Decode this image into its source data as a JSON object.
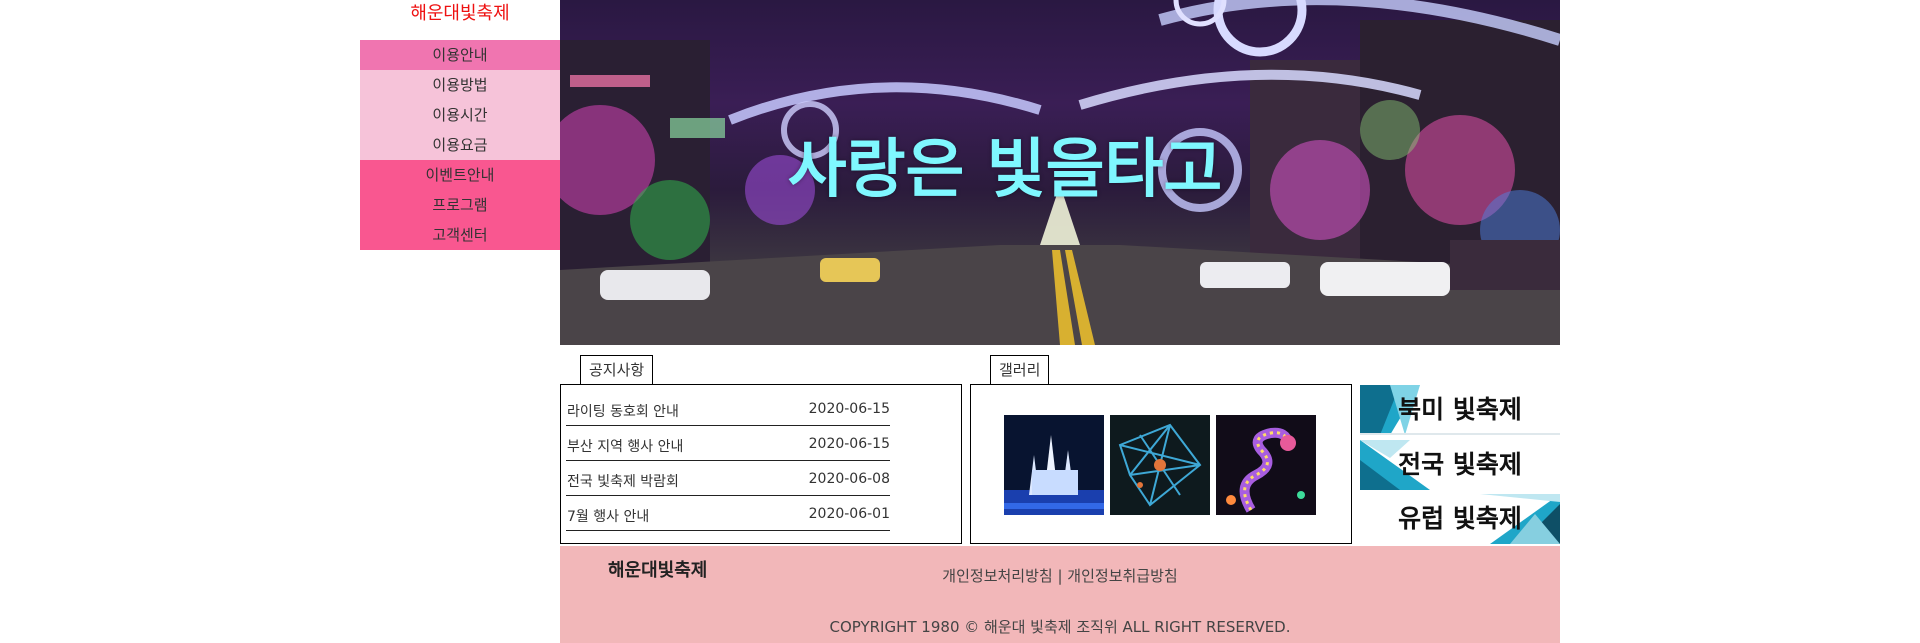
{
  "site": {
    "logo": "해운대빛축제"
  },
  "nav": {
    "items": [
      {
        "label": "이용안내",
        "bg": "#f075b0"
      },
      {
        "label": "이용방법",
        "bg": "#f6c3d9"
      },
      {
        "label": "이용시간",
        "bg": "#f6c3d9"
      },
      {
        "label": "이용요금",
        "bg": "#f6c3d9"
      },
      {
        "label": "이벤트안내",
        "bg": "#f95790"
      },
      {
        "label": "프로그램",
        "bg": "#f95790"
      },
      {
        "label": "고객센터",
        "bg": "#f95790"
      }
    ]
  },
  "hero": {
    "title": "사랑은 빛을타고"
  },
  "notice": {
    "tab_label": "공지사항",
    "rows": [
      {
        "title": "라이팅 동호회 안내",
        "date": "2020-06-15"
      },
      {
        "title": "부산 지역 행사 안내",
        "date": "2020-06-15"
      },
      {
        "title": "전국 빛축제 박람회",
        "date": "2020-06-08"
      },
      {
        "title": "7월 행사 안내",
        "date": "2020-06-01"
      }
    ]
  },
  "gallery": {
    "tab_label": "갤러리",
    "images": [
      "illuminated-castle",
      "light-web-sculpture",
      "light-dragon"
    ]
  },
  "banners": [
    {
      "label": "북미 빛축제"
    },
    {
      "label": "전국 빛축제"
    },
    {
      "label": "유럽 빛축제"
    }
  ],
  "footer": {
    "logo": "해운대빛축제",
    "links": [
      "개인정보처리방침",
      "개인정보취급방침"
    ],
    "separator": " | ",
    "copyright": "COPYRIGHT 1980 © 해운대 빛축제 조직위 ALL RIGHT RESERVED."
  },
  "colors": {
    "logo": "#ee1111",
    "hero_title": "#7ff7ff",
    "footer_bg": "#f2b7b9",
    "banner_accent": "#1fa6c8"
  }
}
